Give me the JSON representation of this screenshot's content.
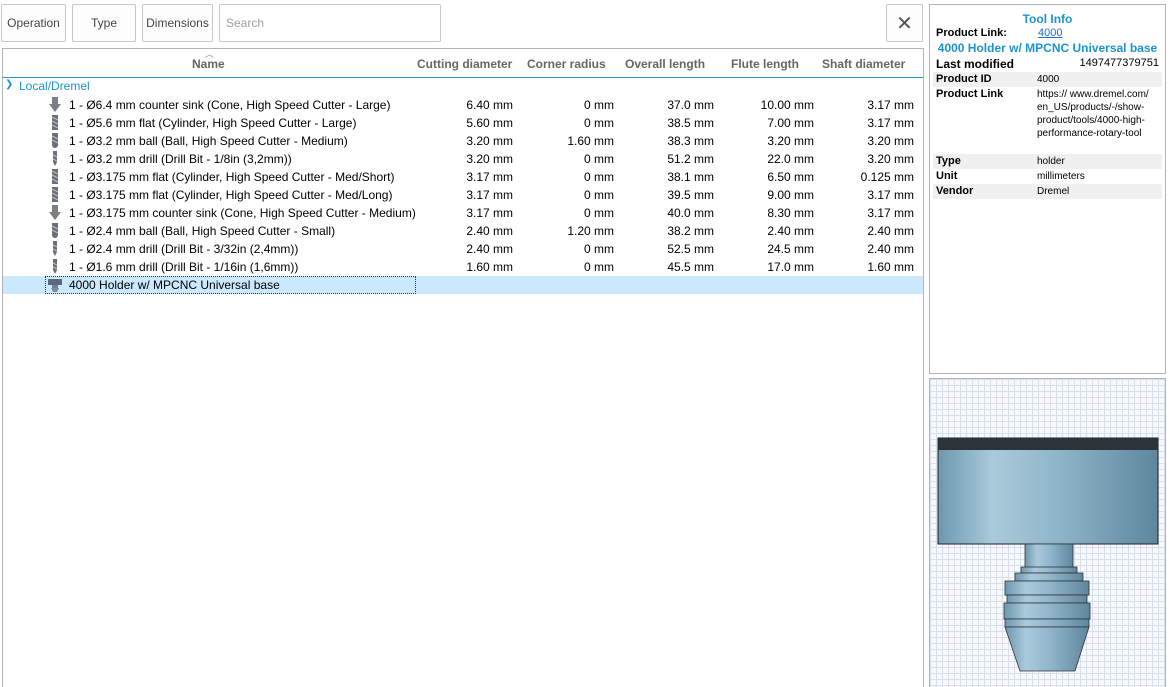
{
  "toolbar": {
    "operation_label": "Operation",
    "type_label": "Type",
    "dimensions_label": "Dimensions",
    "search_placeholder": "Search",
    "close_label": "✕"
  },
  "table": {
    "columns": [
      "Name",
      "Cutting diameter",
      "Corner radius",
      "Overall length",
      "Flute length",
      "Shaft diameter"
    ],
    "group": "Local/Dremel",
    "rows": [
      {
        "icon": "counter-sink-icon",
        "name": "1 - Ø6.4 mm counter sink (Cone, High Speed Cutter - Large)",
        "cutting": "6.40 mm",
        "corner": "0 mm",
        "overall": "37.0 mm",
        "flute": "10.00 mm",
        "shaft": "3.17 mm"
      },
      {
        "icon": "flat-end-mill-icon",
        "name": "1 - Ø5.6 mm flat (Cylinder, High Speed Cutter - Large)",
        "cutting": "5.60 mm",
        "corner": "0 mm",
        "overall": "38.5 mm",
        "flute": "7.00 mm",
        "shaft": "3.17 mm"
      },
      {
        "icon": "ball-end-mill-icon",
        "name": "1 - Ø3.2 mm ball (Ball, High Speed Cutter - Medium)",
        "cutting": "3.20 mm",
        "corner": "1.60 mm",
        "overall": "38.3 mm",
        "flute": "3.20 mm",
        "shaft": "3.20 mm"
      },
      {
        "icon": "drill-icon",
        "name": "1 - Ø3.2 mm drill (Drill Bit - 1/8in (3,2mm))",
        "cutting": "3.20 mm",
        "corner": "0 mm",
        "overall": "51.2 mm",
        "flute": "22.0 mm",
        "shaft": "3.20 mm"
      },
      {
        "icon": "flat-end-mill-icon",
        "name": "1 - Ø3.175 mm flat (Cylinder, High Speed Cutter - Med/Short)",
        "cutting": "3.17 mm",
        "corner": "0 mm",
        "overall": "38.1 mm",
        "flute": "6.50 mm",
        "shaft": "0.125 mm"
      },
      {
        "icon": "flat-end-mill-icon",
        "name": "1 - Ø3.175 mm flat (Cylinder, High Speed Cutter - Med/Long)",
        "cutting": "3.17 mm",
        "corner": "0 mm",
        "overall": "39.5 mm",
        "flute": "9.00 mm",
        "shaft": "3.17 mm"
      },
      {
        "icon": "counter-sink-icon",
        "name": "1 - Ø3.175 mm counter sink (Cone, High Speed Cutter - Medium)",
        "cutting": "3.17 mm",
        "corner": "0 mm",
        "overall": "40.0 mm",
        "flute": "8.30 mm",
        "shaft": "3.17 mm"
      },
      {
        "icon": "ball-end-mill-icon",
        "name": "1 - Ø2.4 mm ball (Ball, High Speed Cutter - Small)",
        "cutting": "2.40 mm",
        "corner": "1.20 mm",
        "overall": "38.2 mm",
        "flute": "2.40 mm",
        "shaft": "2.40 mm"
      },
      {
        "icon": "drill-icon",
        "name": "1 - Ø2.4 mm drill (Drill Bit - 3/32in (2,4mm))",
        "cutting": "2.40 mm",
        "corner": "0 mm",
        "overall": "52.5 mm",
        "flute": "24.5 mm",
        "shaft": "2.40 mm"
      },
      {
        "icon": "drill-icon",
        "name": "1 - Ø1.6 mm drill (Drill Bit - 1/16in (1,6mm))",
        "cutting": "1.60 mm",
        "corner": "0 mm",
        "overall": "45.5 mm",
        "flute": "17.0 mm",
        "shaft": "1.60 mm"
      }
    ],
    "selected_holder": {
      "icon": "holder-icon",
      "name": "4000 Holder w/ MPCNC Universal base"
    }
  },
  "tool_info": {
    "title": "Tool Info",
    "product_link_label": "Product Link:",
    "product_link_value": "4000",
    "name": "4000 Holder w/ MPCNC Universal base",
    "last_modified_label": "Last modified",
    "last_modified_value": "1497477379751",
    "fields": [
      {
        "key": "Product ID",
        "value": "4000"
      },
      {
        "key": "Product Link",
        "value": "https:// www.dremel.com/ en_US/products/-/show-product/tools/4000-high-performance-rotary-tool"
      },
      {
        "key": "Type",
        "value": "holder"
      },
      {
        "key": "Unit",
        "value": "millimeters"
      },
      {
        "key": "Vendor",
        "value": "Dremel"
      }
    ]
  },
  "colors": {
    "accent": "#1a95d0",
    "selection": "#cce8ff",
    "holder_metal": "#8fb4c9"
  }
}
